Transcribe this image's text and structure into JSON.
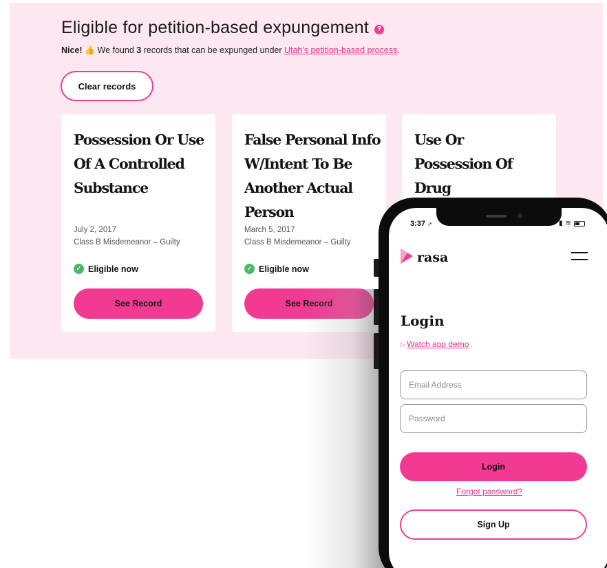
{
  "header": {
    "title": "Eligible for petition-based expungement",
    "help_icon": "?",
    "nice": "Nice!",
    "thumbs": "👍",
    "text_before_count": "We found",
    "count": "3",
    "text_after_count": "records that can be expunged under",
    "link": "Utah's petition-based process",
    "period": "."
  },
  "clear_button": "Clear records",
  "cards": [
    {
      "title": "Possession Or Use Of A Controlled Substance",
      "date": "July 2, 2017",
      "class": "Class B Misdemeanor – Guilty",
      "status": "Eligible now",
      "button": "See Record"
    },
    {
      "title": "False Personal Info W/Intent To Be Another Actual Person",
      "date": "March 5, 2017",
      "class": "Class B Misdemeanor – Guilty",
      "status": "Eligible now",
      "button": "See Record"
    },
    {
      "title": "Use Or Possession Of Drug"
    }
  ],
  "phone": {
    "time": "3:37",
    "brand": "rasa",
    "heading": "Login",
    "demo_link": "Watch app demo",
    "email_placeholder": "Email Address",
    "password_placeholder": "Password",
    "login_button": "Login",
    "forgot": "Forgot password?",
    "signup_button": "Sign Up"
  },
  "colors": {
    "accent": "#f23a93",
    "panel_bg": "#fde8f1",
    "success": "#4cb865"
  }
}
